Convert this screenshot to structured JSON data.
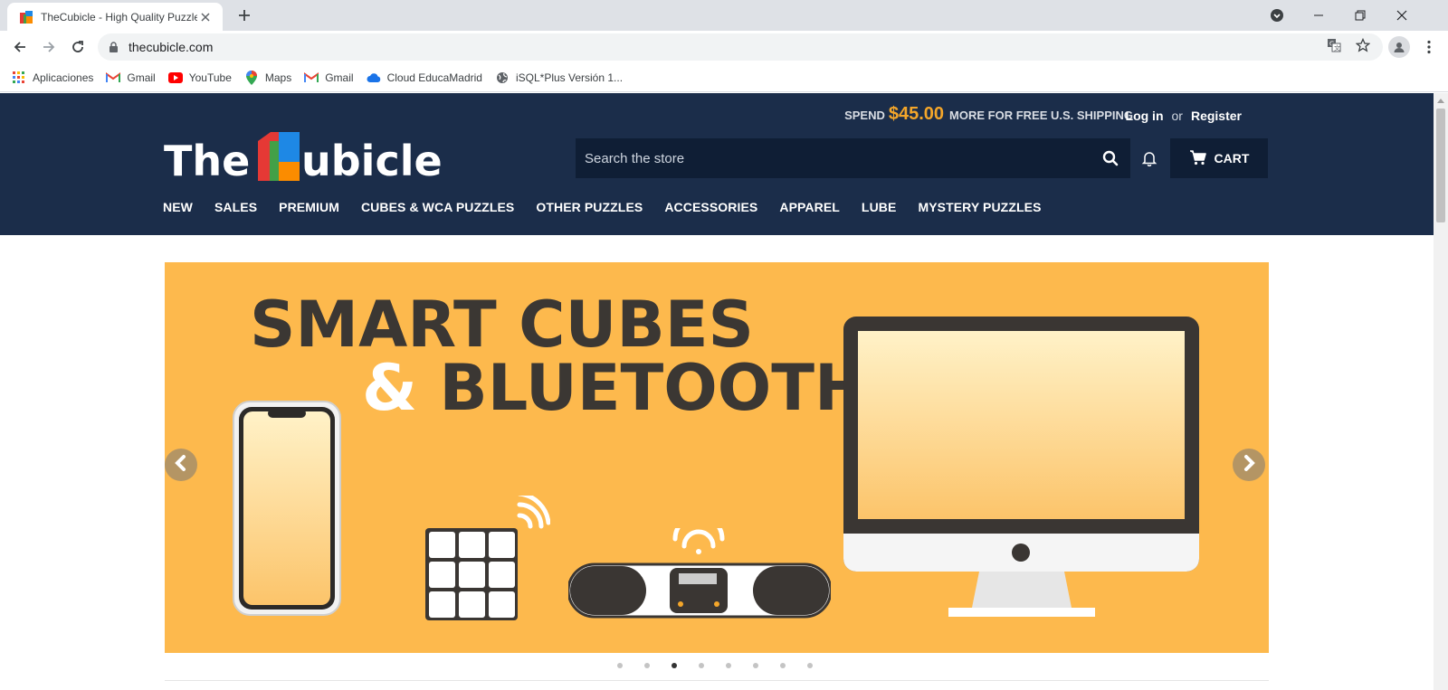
{
  "browser": {
    "tab_title": "TheCubicle - High Quality Puzzles",
    "url": "thecubicle.com",
    "icons": {
      "back": "arrow-left-icon",
      "forward": "arrow-right-icon",
      "reload": "reload-icon",
      "lock": "lock-icon",
      "translate": "translate-icon",
      "bookmark": "star-icon",
      "profile": "profile-icon",
      "menu": "kebab-menu-icon",
      "newtab": "plus-icon",
      "minimize": "minimize-icon",
      "restore": "restore-icon",
      "close": "close-icon",
      "tabsearch": "tab-search-icon"
    }
  },
  "bookmarks": [
    {
      "label": "Aplicaciones",
      "icon": "apps-grid-icon"
    },
    {
      "label": "Gmail",
      "icon": "gmail-icon"
    },
    {
      "label": "YouTube",
      "icon": "youtube-icon"
    },
    {
      "label": "Maps",
      "icon": "maps-icon"
    },
    {
      "label": "Gmail",
      "icon": "gmail-icon"
    },
    {
      "label": "Cloud EducaMadrid",
      "icon": "cloud-icon"
    },
    {
      "label": "iSQL*Plus Versión 1...",
      "icon": "globe-icon"
    }
  ],
  "header": {
    "promo_prefix": "SPEND",
    "promo_amount": "$45.00",
    "promo_suffix": "MORE FOR FREE U.S. SHIPPING",
    "login": "Log in",
    "or": "or",
    "register": "Register",
    "logo_text_left": "The",
    "logo_text_right": "ubicle",
    "search_placeholder": "Search the store",
    "cart_label": "CART"
  },
  "nav": [
    {
      "label": "NEW"
    },
    {
      "label": "SALES"
    },
    {
      "label": "PREMIUM"
    },
    {
      "label": "CUBES & WCA PUZZLES"
    },
    {
      "label": "OTHER PUZZLES"
    },
    {
      "label": "ACCESSORIES"
    },
    {
      "label": "APPAREL"
    },
    {
      "label": "LUBE"
    },
    {
      "label": "MYSTERY PUZZLES"
    }
  ],
  "hero": {
    "title_line1": "SMART CUBES",
    "title_amp": "&",
    "title_line2": "BLUETOOTH",
    "background": "#fdb94d",
    "slide_count": 8,
    "active_slide": 3
  },
  "colors": {
    "header_bg": "#1b2d4a",
    "accent": "#f4a62a"
  }
}
